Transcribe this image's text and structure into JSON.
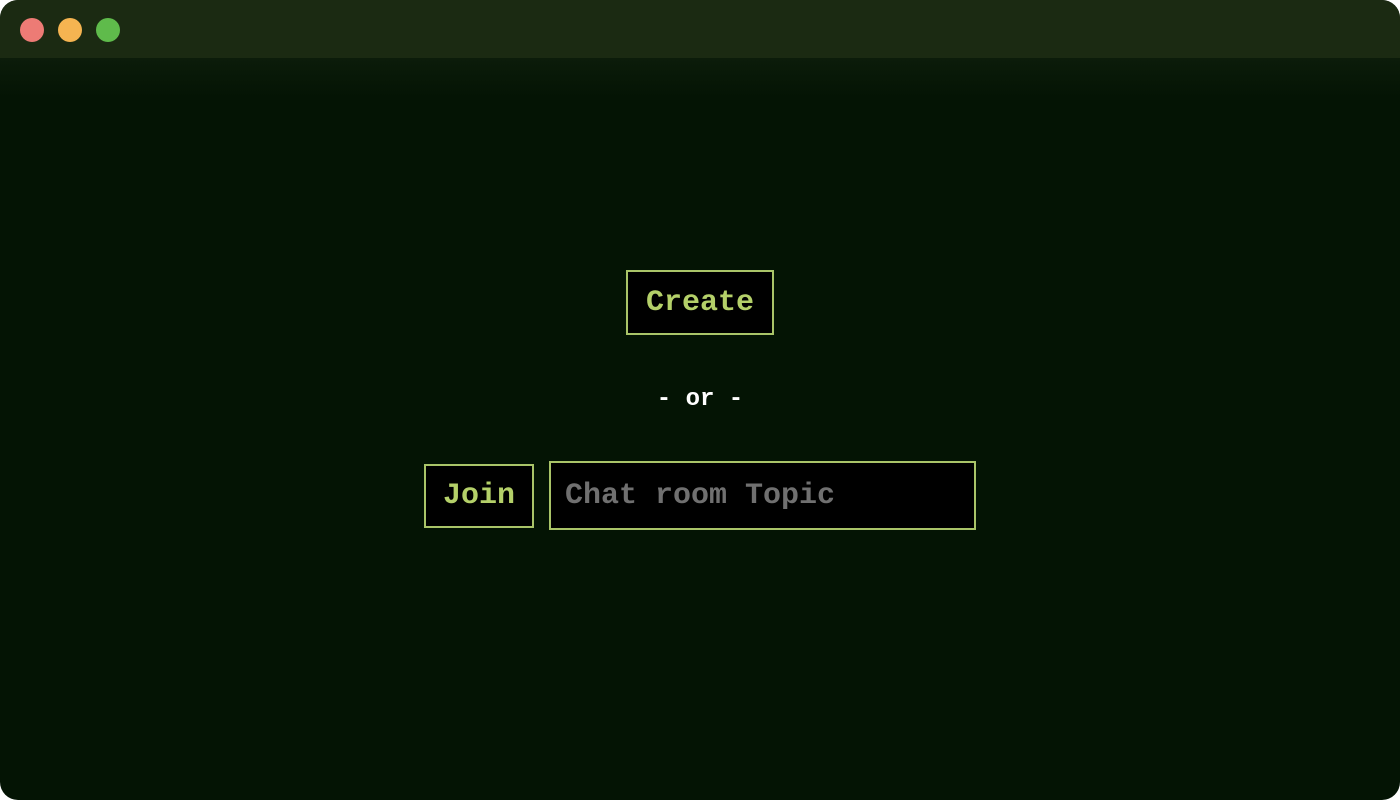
{
  "window": {
    "controls": [
      "close",
      "minimize",
      "zoom"
    ],
    "colors": {
      "background": "#041404",
      "titlebar": "#1b2a12",
      "accent": "#b4d069",
      "border": "#a9c468",
      "close": "#ed7b75",
      "minimize": "#f5b451",
      "zoom": "#5fbb4b"
    }
  },
  "main": {
    "create_label": "Create",
    "or_label": "- or -",
    "join_label": "Join",
    "topic_input": {
      "placeholder": "Chat room Topic",
      "value": ""
    }
  }
}
